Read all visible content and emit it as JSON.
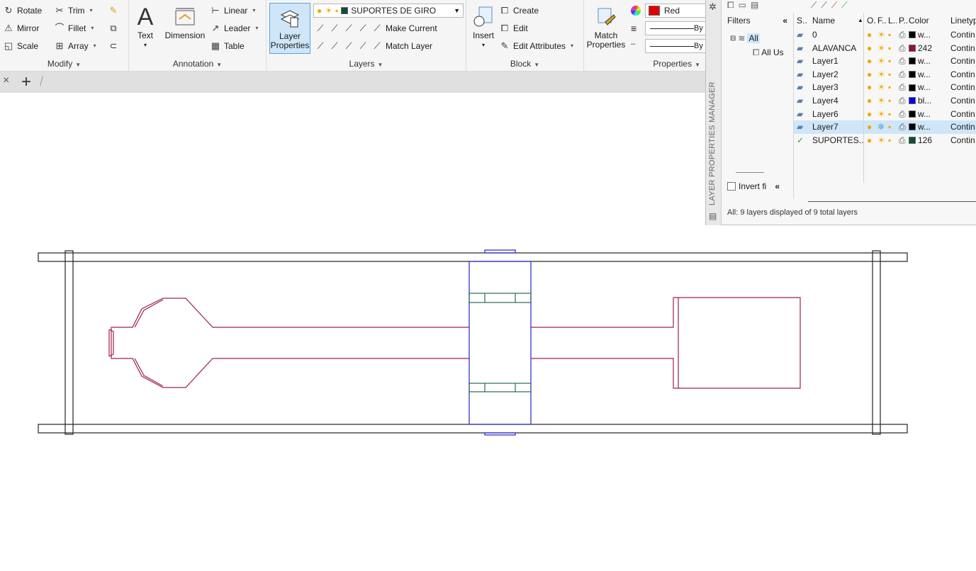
{
  "ribbon": {
    "modify": {
      "title": "Modify",
      "rotate": "Rotate",
      "trim": "Trim",
      "mirror": "Mirror",
      "fillet": "Fillet",
      "scale": "Scale",
      "array": "Array"
    },
    "annotation": {
      "title": "Annotation",
      "text": "Text",
      "dimension": "Dimension",
      "linear": "Linear",
      "leader": "Leader",
      "table": "Table"
    },
    "layers": {
      "title": "Layers",
      "layer_properties": "Layer Properties",
      "current_layer": "SUPORTES DE GIRO",
      "current_layer_color": "#0e4d3a",
      "make_current": "Make Current",
      "match_layer": "Match Layer"
    },
    "block": {
      "title": "Block",
      "insert": "Insert",
      "create": "Create",
      "edit": "Edit",
      "edit_attributes": "Edit Attributes"
    },
    "properties": {
      "title": "Properties",
      "match_properties": "Match Properties",
      "color": "Red",
      "color_hex": "#e00000",
      "linetype": "By",
      "lineweight": "By"
    }
  },
  "tabs": {
    "close": "×",
    "add": "+",
    "sep": "/"
  },
  "lpm": {
    "vertical_title": "LAYER PROPERTIES MANAGER",
    "filters_label": "Filters",
    "tree_all": "All",
    "tree_used": "All Us",
    "invert_label": "Invert fi",
    "headers": {
      "s": "S..",
      "name": "Name",
      "o": "O..",
      "f": "F..",
      "l": "L..",
      "p": "P..",
      "color": "Color",
      "linetype": "Linetyp"
    },
    "layers": [
      {
        "name": "0",
        "color_name": "w...",
        "color_hex": "#000000",
        "linetype": "Contin",
        "current": false,
        "frozen": false
      },
      {
        "name": "ALAVANCA",
        "color_name": "242",
        "color_hex": "#9b1030",
        "linetype": "Contin",
        "current": false,
        "frozen": false
      },
      {
        "name": "Layer1",
        "color_name": "w...",
        "color_hex": "#000000",
        "linetype": "Contin",
        "current": false,
        "frozen": false
      },
      {
        "name": "Layer2",
        "color_name": "w...",
        "color_hex": "#000000",
        "linetype": "Contin",
        "current": false,
        "frozen": false
      },
      {
        "name": "Layer3",
        "color_name": "w...",
        "color_hex": "#000000",
        "linetype": "Contin",
        "current": false,
        "frozen": false
      },
      {
        "name": "Layer4",
        "color_name": "bl...",
        "color_hex": "#0000ee",
        "linetype": "Contin",
        "current": false,
        "frozen": false
      },
      {
        "name": "Layer6",
        "color_name": "w...",
        "color_hex": "#000000",
        "linetype": "Contin",
        "current": false,
        "frozen": false
      },
      {
        "name": "Layer7",
        "color_name": "w...",
        "color_hex": "#000000",
        "linetype": "Contin",
        "current": false,
        "frozen": true,
        "selected": true
      },
      {
        "name": "SUPORTES...",
        "color_name": "126",
        "color_hex": "#0e4d3a",
        "linetype": "Contin",
        "current": true,
        "frozen": false
      }
    ],
    "status": "All: 9 layers displayed of 9 total layers"
  },
  "drawing": {
    "frame_color": "#222222",
    "alavanca_color": "#a0204a",
    "support_color": "#2a6b52",
    "blue_color": "#3333cc"
  }
}
